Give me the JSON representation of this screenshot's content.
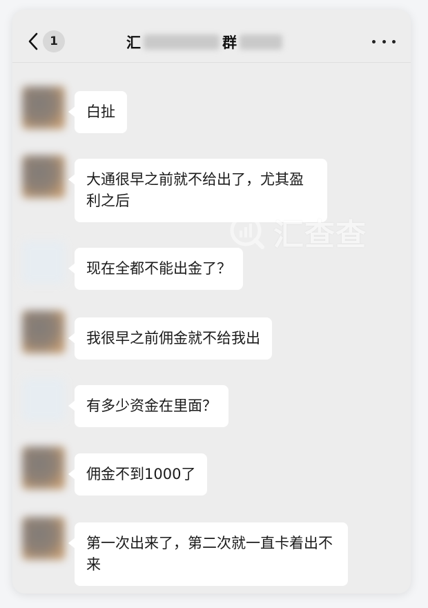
{
  "header": {
    "back_icon": "chevron-left-icon",
    "unread_count": "1",
    "title_prefix": "汇",
    "title_middle": "群",
    "more_icon": "more-horizontal-icon"
  },
  "messages": [
    {
      "text": "白扯",
      "avatar": "photo"
    },
    {
      "text": "大通很早之前就不给出了，尤其盈利之后",
      "avatar": "photo"
    },
    {
      "text": "现在全都不能出金了？",
      "avatar": "light"
    },
    {
      "text": "我很早之前佣金就不给我出",
      "avatar": "photo"
    },
    {
      "text": "有多少资金在里面？",
      "avatar": "light"
    },
    {
      "text": "佣金不到1000了",
      "avatar": "photo"
    },
    {
      "text": "第一次出来了，第二次就一直卡着出不来",
      "avatar": "photo"
    }
  ],
  "watermark": {
    "text": "汇查查"
  }
}
